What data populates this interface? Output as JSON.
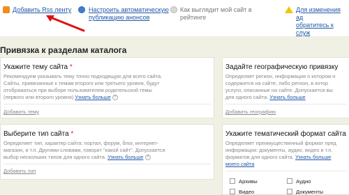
{
  "toolbar": {
    "add_rss": "Добавить Rss ленту",
    "setup_auto_line1": "Настроить автоматическую",
    "setup_auto_line2": "публикацию анонсов",
    "rating_line1": "Как выглядит мой сайт в",
    "rating_line2": "рейтинге",
    "changes_line1": "Для изменения ад",
    "changes_line2": "обратитесь к служ"
  },
  "section_title": "Привязка к разделам каталога",
  "topic": {
    "title": "Укажите тему сайта",
    "text1": "Рекомендуем указывать тему точно подходящую для всего сайта.",
    "text2": "Сайты, привязанные к темам второго или третьего уровня, будут",
    "text3": "отображаться при выборе пользователем родительской темы",
    "text4": "(первого или второго уровня)",
    "more": "Узнать больше",
    "help": "?",
    "add": "Добавить тему"
  },
  "type": {
    "title": "Выберите тип сайта",
    "text1": "Определяет тип, характер сайта: портал, форум, блог, интернет-",
    "text2": "магазин, и т.п. Другими словами, говорит \"какой сайт\". Допускается",
    "text3": "выбор нескольких типов для одного сайта.",
    "more": "Узнать больше",
    "help": "?",
    "add": "Добавить тип"
  },
  "geo": {
    "title": "Задайте географическую привязку",
    "text1": "Определяет регион, информация о котором н",
    "text2": "содержится на сайте, либо регион, в котор",
    "text3": "услуги, описанные на сайте. Допускается вы",
    "text4": "для одного сайта.",
    "more": "Узнать больше",
    "add": "Добавить географию"
  },
  "format": {
    "title": "Укажите тематический формат сайта",
    "text1": "Определяет преимущественный формат пред",
    "text2": "информации: документы, аудио, видео и т.п.",
    "text3": "форматов для одного сайта.",
    "more_inline": "Узнать больше",
    "more2": "моего сайта",
    "checks": [
      "Архивы",
      "Аудио",
      "Видео",
      "Документы"
    ]
  }
}
